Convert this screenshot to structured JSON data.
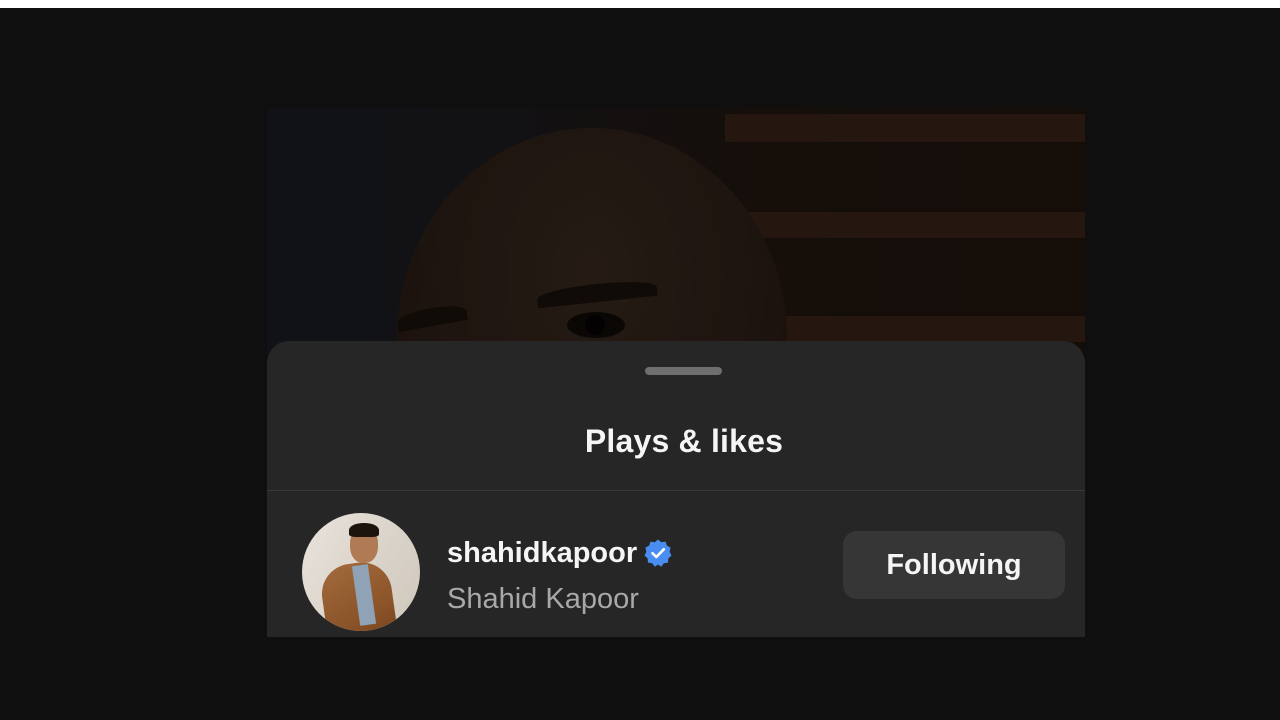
{
  "sheet": {
    "title": "Plays & likes"
  },
  "user": {
    "username": "shahidkapoor",
    "full_name": "Shahid Kapoor",
    "verified": true,
    "follow_button_label": "Following"
  },
  "colors": {
    "sheet_background": "#262626",
    "verified_badge": "#4a8df0",
    "button_background": "#363636",
    "secondary_text": "#a8a8a8"
  },
  "icons": {
    "verified": "verified-badge-icon",
    "avatar": "profile-photo"
  }
}
